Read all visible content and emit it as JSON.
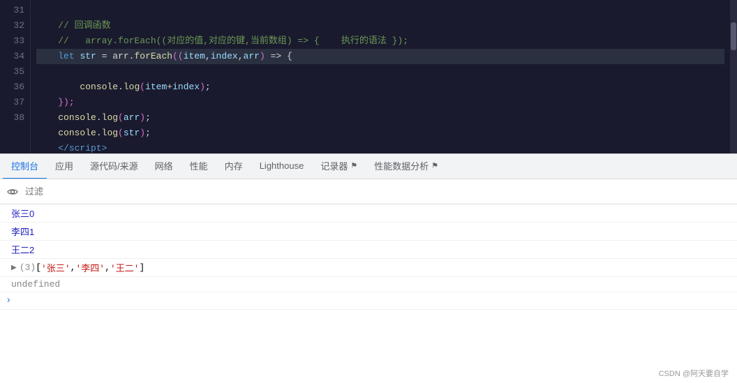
{
  "code": {
    "lines": [
      {
        "num": "31",
        "tokens": [
          {
            "text": "    // ",
            "cls": "c-comment"
          },
          {
            "text": "回调函数",
            "cls": "c-chinese"
          }
        ]
      },
      {
        "num": "32",
        "tokens": [
          {
            "text": "    // ",
            "cls": "c-comment"
          },
          {
            "text": "   array.forEach((对应的值,对应的键,当前数组) => {",
            "cls": "c-comment"
          },
          {
            "text": "    执行的语法",
            "cls": "c-comment"
          },
          {
            "text": " });",
            "cls": "c-comment"
          }
        ]
      },
      {
        "num": "33",
        "tokens": [
          {
            "text": "    ",
            "cls": ""
          },
          {
            "text": "let",
            "cls": "c-keyword"
          },
          {
            "text": " str = arr.",
            "cls": "c-operator"
          },
          {
            "text": "forEach",
            "cls": "c-function"
          },
          {
            "text": "((",
            "cls": "c-paren"
          },
          {
            "text": "item",
            "cls": "c-param"
          },
          {
            "text": ",",
            "cls": "c-punct"
          },
          {
            "text": "index",
            "cls": "c-param"
          },
          {
            "text": ",",
            "cls": "c-punct"
          },
          {
            "text": "arr",
            "cls": "c-param"
          },
          {
            "text": ") => {",
            "cls": "c-operator"
          }
        ],
        "highlight": true
      },
      {
        "num": "34",
        "tokens": [
          {
            "text": "        console.",
            "cls": "c-function"
          },
          {
            "text": "log",
            "cls": "c-function"
          },
          {
            "text": "(item+index);",
            "cls": "c-paren"
          }
        ]
      },
      {
        "num": "35",
        "tokens": [
          {
            "text": "    ",
            "cls": ""
          },
          {
            "text": "});",
            "cls": "c-paren"
          }
        ]
      },
      {
        "num": "36",
        "tokens": [
          {
            "text": "    console.",
            "cls": "c-function"
          },
          {
            "text": "log",
            "cls": "c-function"
          },
          {
            "text": "(arr);",
            "cls": "c-paren"
          }
        ]
      },
      {
        "num": "37",
        "tokens": [
          {
            "text": "    console.",
            "cls": "c-function"
          },
          {
            "text": "log",
            "cls": "c-function"
          },
          {
            "text": "(str);",
            "cls": "c-paren"
          }
        ]
      },
      {
        "num": "38",
        "tokens": [
          {
            "text": "    ",
            "cls": ""
          },
          {
            "text": "</",
            "cls": "c-tag"
          },
          {
            "text": "script",
            "cls": "c-tag"
          },
          {
            "text": ">",
            "cls": "c-tag"
          }
        ]
      }
    ]
  },
  "tabs": [
    {
      "label": "控制台",
      "active": true
    },
    {
      "label": "应用",
      "active": false
    },
    {
      "label": "源代码/来源",
      "active": false
    },
    {
      "label": "网络",
      "active": false
    },
    {
      "label": "性能",
      "active": false
    },
    {
      "label": "内存",
      "active": false
    },
    {
      "label": "Lighthouse",
      "active": false
    },
    {
      "label": "记录器",
      "active": false,
      "icon": "⚑"
    },
    {
      "label": "性能数据分析",
      "active": false,
      "icon": "⚑"
    }
  ],
  "console": {
    "filter_placeholder": "过滤",
    "output": [
      {
        "type": "output",
        "text": "张三0"
      },
      {
        "type": "output",
        "text": "李四1"
      },
      {
        "type": "output",
        "text": "王二2"
      },
      {
        "type": "array",
        "text": "▶ (3) ['张三', '李四', '王二']"
      },
      {
        "type": "undefined",
        "text": "undefined"
      },
      {
        "type": "prompt",
        "text": ">"
      }
    ]
  },
  "watermark": "CSDN @阿天要自学"
}
